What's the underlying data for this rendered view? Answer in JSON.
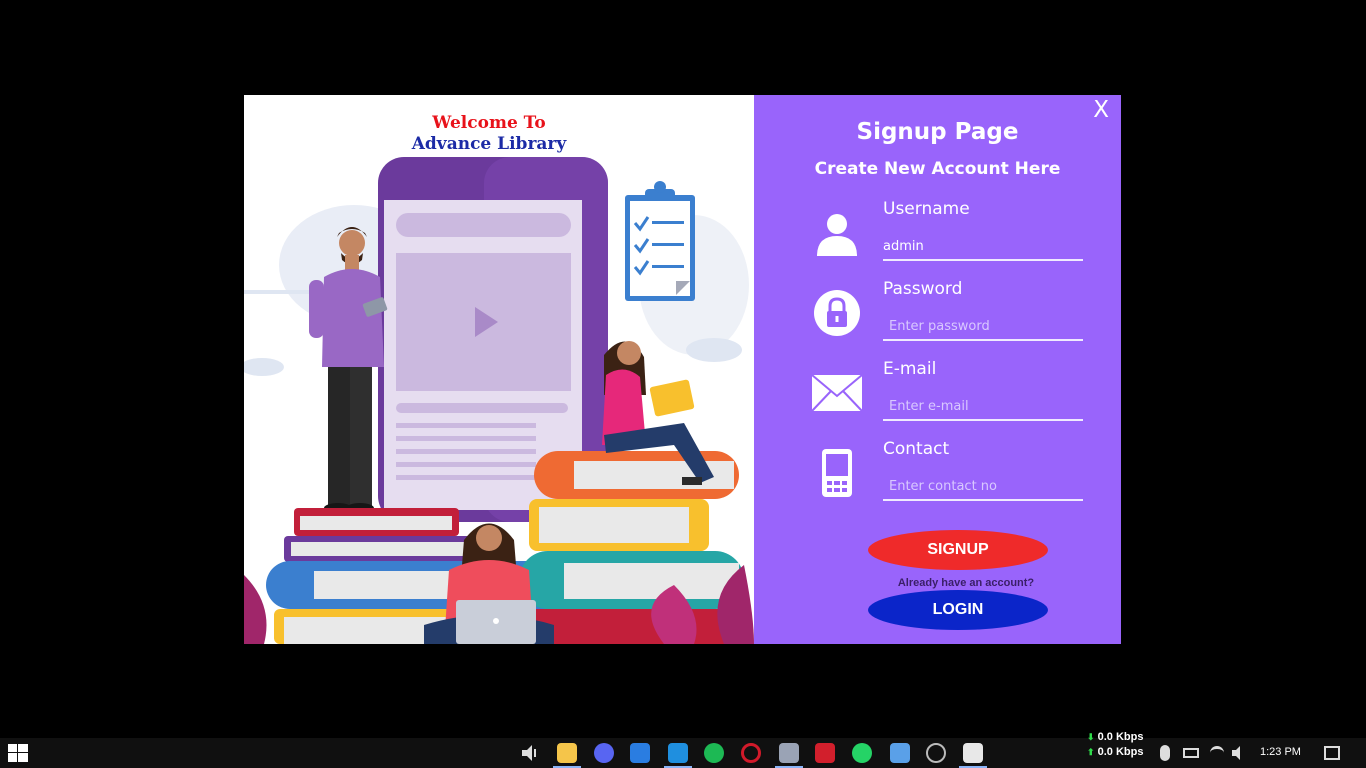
{
  "left": {
    "welcome_line1": "Welcome To",
    "welcome_line2": "Advance Library"
  },
  "signup": {
    "close_label": "X",
    "title": "Signup Page",
    "subtitle": "Create New Account Here",
    "fields": [
      {
        "label": "Username",
        "value": "admin",
        "placeholder": ""
      },
      {
        "label": "Password",
        "value": "",
        "placeholder": "Enter password"
      },
      {
        "label": "E-mail",
        "value": "",
        "placeholder": "Enter e-mail"
      },
      {
        "label": "Contact",
        "value": "",
        "placeholder": "Enter contact no"
      }
    ],
    "signup_button": "SIGNUP",
    "already_text": "Already have an account?",
    "login_button": "LOGIN"
  },
  "taskbar": {
    "upload_rate": "0.0 Kbps",
    "download_rate": "0.0 Kbps",
    "time": "1:23 PM",
    "apps": [
      "sound-app",
      "file-explorer",
      "discord",
      "microsoft-store",
      "app-blue",
      "spotify",
      "opera",
      "app-gray",
      "app-red",
      "whatsapp",
      "app-gem",
      "app-circle",
      "java-app"
    ]
  },
  "colors": {
    "panel_purple": "#9964fb",
    "signup_red": "#ef2a2a",
    "login_blue": "#0b25c9",
    "welcome_red": "#e8121a",
    "welcome_blue": "#1c2ba6"
  }
}
